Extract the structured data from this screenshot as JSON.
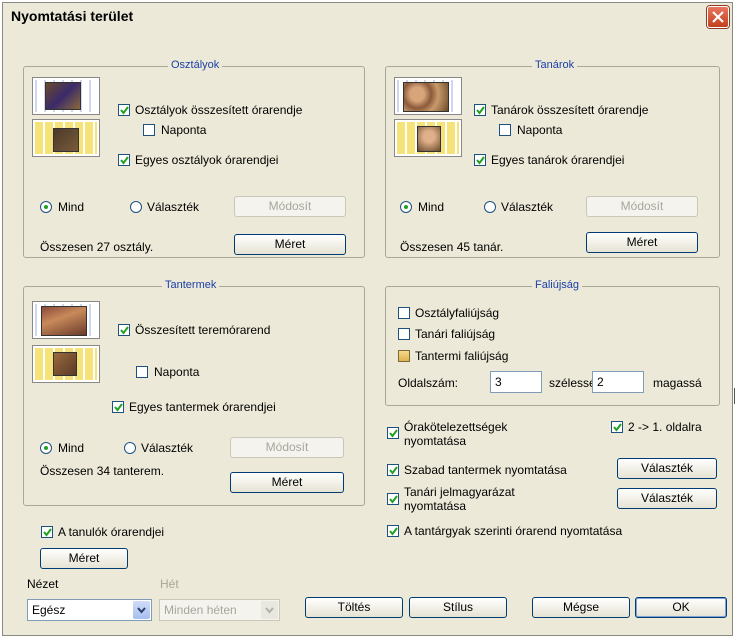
{
  "dialog": {
    "title": "Nyomtatási terület"
  },
  "osztalyok": {
    "legend": "Osztályok",
    "summary_cb": "Osztályok összesített órarendje",
    "daily_cb": "Naponta",
    "each_cb": "Egyes osztályok órarendjei",
    "radio_all": "Mind",
    "radio_select": "Választék",
    "modify_btn": "Módosít",
    "total": "Összesen 27 osztály.",
    "size_btn": "Méret"
  },
  "tanarok": {
    "legend": "Tanárok",
    "summary_cb": "Tanárok összesített órarendje",
    "daily_cb": "Naponta",
    "each_cb": "Egyes tanárok órarendjei",
    "radio_all": "Mind",
    "radio_select": "Választék",
    "modify_btn": "Módosít",
    "total": "Összesen 45 tanár.",
    "size_btn": "Méret"
  },
  "tantermek": {
    "legend": "Tantermek",
    "summary_cb": "Összesített teremórarend",
    "daily_cb": "Naponta",
    "each_cb": "Egyes tantermek órarendjei",
    "radio_all": "Mind",
    "radio_select": "Választék",
    "modify_btn": "Módosít",
    "total": "Összesen 34 tanterem.",
    "size_btn": "Méret"
  },
  "falujsag": {
    "legend": "Faliújság",
    "class_cb": "Osztályfaliújság",
    "teacher_cb": "Tanári faliújság",
    "room_cb": "Tantermi faliújság",
    "page_label": "Oldalszám:",
    "width_value": "3",
    "width_label": "szélesség",
    "height_value": "2",
    "height_label": "magasság"
  },
  "options": {
    "bound_lessons": "Órakötelezettségek nyomtatása",
    "two_to_one": "2 -> 1. oldalra",
    "free_rooms": "Szabad tantermek nyomtatása",
    "free_rooms_btn": "Választék",
    "teacher_legend": "Tanári jelmagyarázat nyomtatása",
    "teacher_legend_btn": "Választék",
    "subject_print": "A tantárgyak szerinti órarend nyomtatása"
  },
  "students": {
    "checkbox": "A tanulók órarendjei",
    "size_btn": "Méret"
  },
  "view": {
    "label": "Nézet",
    "value": "Egész",
    "week_label": "Hét",
    "week_value": "Minden héten"
  },
  "buttons": {
    "fill": "Töltés",
    "style": "Stílus",
    "cancel": "Mégse",
    "ok": "OK"
  },
  "colors": {
    "legend_text": "#1a3fa8",
    "dialog_bg": "#ece9d8",
    "check_green": "#21a121"
  }
}
